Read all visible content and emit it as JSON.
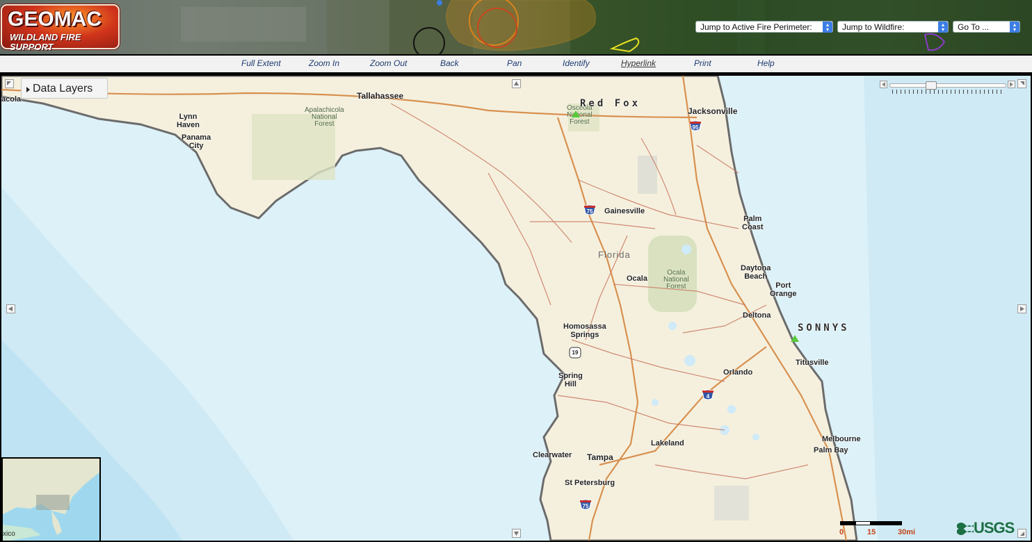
{
  "header": {
    "logo_title": "GEOMAC",
    "logo_subtitle": "WILDLAND FIRE SUPPORT",
    "perimeter_select": "Jump to Active Fire Perimeter:",
    "wildfire_select": "Jump to Wildfire:",
    "goto_select": "Go To ..."
  },
  "toolbar": {
    "tools": [
      "Full Extent",
      "Zoom In",
      "Zoom Out",
      "Back",
      "Pan",
      "Identify",
      "Hyperlink",
      "Print",
      "Help"
    ]
  },
  "map": {
    "data_layers_label": "Data Layers",
    "state_label": "Florida",
    "fires": [
      "Red Fox",
      "SONNYS"
    ],
    "cities": {
      "pensacola": "acola",
      "tallahassee": "Tallahassee",
      "lynn_haven": "Lynn\nHaven",
      "panama_city": "Panama\nCity",
      "jacksonville": "Jacksonville",
      "gainesville": "Gainesville",
      "palm_coast": "Palm\nCoast",
      "ocala": "Ocala",
      "daytona": "Daytona\nBeach",
      "port_orange": "Port\nOrange",
      "deltona": "Deltona",
      "homosassa": "Homosassa\nSprings",
      "titusville": "Titusville",
      "orlando": "Orlando",
      "spring_hill": "Spring\nHill",
      "lakeland": "Lakeland",
      "melbourne": "Melbourne",
      "palm_bay": "Palm Bay",
      "clearwater": "Clearwater",
      "tampa": "Tampa",
      "st_petersburg": "St Petersburg"
    },
    "forests": {
      "apalachicola": "Apalachicola\nNational\nForest",
      "osceola": "Osceola\nNational\nForest",
      "ocala_nf": "Ocala\nNational\nForest"
    },
    "highways": {
      "i95": "95",
      "i75_north": "75",
      "us19": "19",
      "i4": "4",
      "i75_south": "75"
    },
    "overview_label": "xico",
    "scale": {
      "s0": "0",
      "s15": "15",
      "s30": "30mi"
    },
    "attribution": "USGS"
  }
}
